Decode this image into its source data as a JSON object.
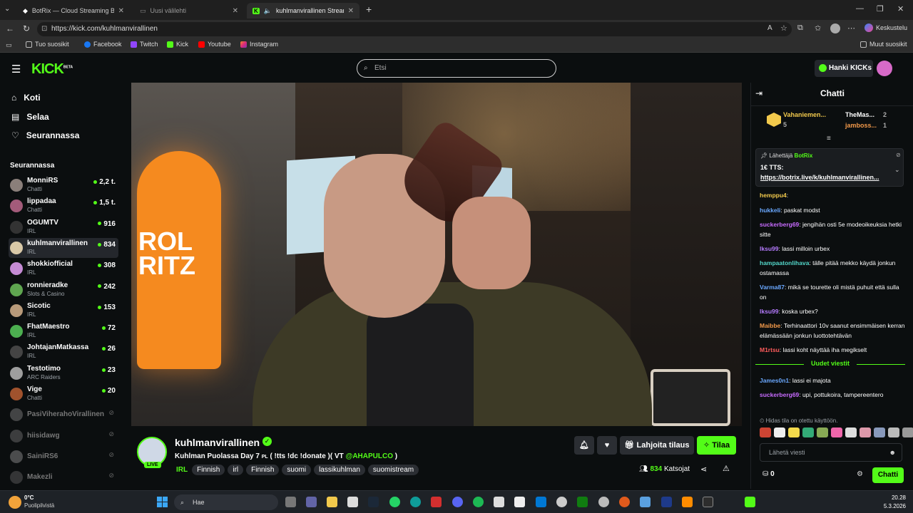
{
  "browser": {
    "tabs": [
      {
        "label": "BotRix — Cloud Streaming Bot for",
        "active": false
      },
      {
        "label": "Uusi välilehti",
        "active": false
      },
      {
        "label": "kuhlmanvirallinen Stream - W",
        "active": true
      }
    ],
    "url": "https://kick.com/kuhlmanvirallinen",
    "profile_button": "Keskustelu",
    "bookmarks": [
      "Tuo suosikit",
      "Facebook",
      "Twitch",
      "Kick",
      "Youtube",
      "Instagram"
    ],
    "other_bookmarks": "Muut suosikit"
  },
  "header": {
    "logo": "KICK",
    "logo_badge": "BETA",
    "search_placeholder": "Etsi",
    "get_kicks": "Hanki KICKs"
  },
  "sidebar": {
    "nav": [
      "Koti",
      "Selaa",
      "Seurannassa"
    ],
    "following_heading": "Seurannassa",
    "channels": [
      {
        "name": "MonniRS",
        "category": "Chatti",
        "viewers": "2,2 t.",
        "color": "#8a7f7a",
        "live": true
      },
      {
        "name": "lippadaa",
        "category": "Chatti",
        "viewers": "1,5 t.",
        "color": "#a35b7a",
        "live": true
      },
      {
        "name": "OGUMTV",
        "category": "IRL",
        "viewers": "916",
        "color": "#333333",
        "live": true
      },
      {
        "name": "kuhlmanvirallinen",
        "category": "IRL",
        "viewers": "834",
        "color": "#d9c9a8",
        "live": true,
        "selected": true
      },
      {
        "name": "shokkiofficial",
        "category": "IRL",
        "viewers": "308",
        "color": "#c58bd4",
        "live": true
      },
      {
        "name": "ronnieradke",
        "category": "Slots & Casino",
        "viewers": "242",
        "color": "#5fa650",
        "live": true
      },
      {
        "name": "Sicotic",
        "category": "IRL",
        "viewers": "153",
        "color": "#b89a7a",
        "live": true
      },
      {
        "name": "FhatMaestro",
        "category": "IRL",
        "viewers": "72",
        "color": "#4caf50",
        "live": true
      },
      {
        "name": "JohtajanMatkassa",
        "category": "IRL",
        "viewers": "26",
        "color": "#444444",
        "live": true
      },
      {
        "name": "Testotimo",
        "category": "ARC Raiders",
        "viewers": "23",
        "color": "#9e9e9e",
        "live": true
      },
      {
        "name": "Vige",
        "category": "Chatti",
        "viewers": "20",
        "color": "#a0522d",
        "live": true
      },
      {
        "name": "PasiViherahoVirallinen",
        "category": "",
        "viewers": "",
        "color": "#888888",
        "live": false
      },
      {
        "name": "hiisidawg",
        "category": "",
        "viewers": "",
        "color": "#777777",
        "live": false
      },
      {
        "name": "SainiRS6",
        "category": "",
        "viewers": "",
        "color": "#999999",
        "live": false
      },
      {
        "name": "Makezli",
        "category": "",
        "viewers": "",
        "color": "#666666",
        "live": false
      }
    ]
  },
  "stream": {
    "streamer": "kuhlmanvirallinen",
    "live_badge": "LIVE",
    "title_prefix": "Kuhlman Puolassa Day 7",
    "title_mid": "( !tts !dc !donate )( VT",
    "title_handle": "@AHAPULCO",
    "title_suffix": ")",
    "tags": [
      "IRL",
      "Finnish",
      "irl",
      "Finnish",
      "suomi",
      "lassikuhlman",
      "suomistream"
    ],
    "gift_button": "Lahjoita tilaus",
    "subscribe_button": "Tilaa",
    "viewer_count": "834",
    "viewer_label": "Katsojat",
    "video_sign": "ROL\nRITZ"
  },
  "chat": {
    "title": "Chatti",
    "leaderboard": [
      {
        "name": "Vahaniemen...",
        "count": "5"
      },
      {
        "name": "TheMas...",
        "count": "2"
      },
      {
        "name": "jamboss...",
        "count": "1"
      }
    ],
    "pinned": {
      "header": "Lähettäjä",
      "sender": "BotRix",
      "line1": "1€ TTS:",
      "link": "https://botrix.live/k/kuhlmanvirallinen..."
    },
    "messages": [
      {
        "user": "hemppu4",
        "text": "",
        "color": "#f2c94c"
      },
      {
        "user": "hukkeli",
        "text": "paskat modst",
        "color": "#6aa8ff"
      },
      {
        "user": "suckerberg69",
        "text": "jengihän osti 5e modeoikeuksia hetki sitte",
        "color": "#c86bff"
      },
      {
        "user": "lksu99",
        "text": "lassi milloin urbex",
        "color": "#b57bff"
      },
      {
        "user": "hampaatonlihava",
        "text": "tälle pitää mekko käydä jonkun ostamassa",
        "color": "#53d6c9"
      },
      {
        "user": "Varma87",
        "text": "mikä se tourette oli mistä puhuit että sulla on",
        "color": "#6aa8ff"
      },
      {
        "user": "lksu99",
        "text": "koska urbex?",
        "color": "#b57bff"
      },
      {
        "user": "Maibbe",
        "text": "Terhinaattori 10v saanut ensimmäisen kerran elämässään jonkun luottotehtävän",
        "color": "#f2994a"
      },
      {
        "user": "M1rtsu",
        "text": "lassi koht näyttää iha megikselt",
        "color": "#ff5c5c"
      }
    ],
    "new_messages_label": "Uudet viestit",
    "new_messages": [
      {
        "user": "James0n1",
        "text": "lassi ei majota",
        "color": "#6aa8ff"
      },
      {
        "user": "suckerberg69",
        "text": "upi, pottukoira, tampereentero",
        "color": "#c86bff"
      }
    ],
    "slow_mode": "Hidas tila on otettu käyttöön.",
    "input_placeholder": "Lähetä viesti",
    "points": "0",
    "send_button": "Chatti"
  },
  "taskbar": {
    "weather_temp": "0°C",
    "weather_text": "Puolipilvistä",
    "search": "Hae",
    "time": "20.28",
    "date": "5.3.2026"
  }
}
